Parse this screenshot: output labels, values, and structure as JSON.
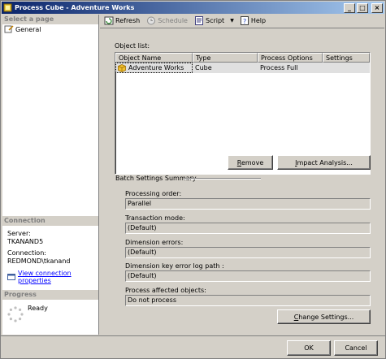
{
  "window": {
    "title": "Process Cube - Adventure Works",
    "controls": {
      "minimize": "_",
      "maximize": "□",
      "close": "×"
    }
  },
  "left_pane": {
    "select_page_heading": "Select a page",
    "pages": [
      {
        "label": "General",
        "icon": "page-icon"
      }
    ],
    "connection": {
      "heading": "Connection",
      "server_label": "Server:",
      "server_value": "TKANAND5",
      "connection_label": "Connection:",
      "connection_value": "REDMOND\\tkanand",
      "view_link": "View connection properties",
      "view_link_icon": "properties-icon"
    },
    "progress": {
      "heading": "Progress",
      "status": "Ready",
      "icon": "spinner-icon"
    }
  },
  "toolbar": {
    "refresh": "Refresh",
    "schedule": "Schedule",
    "script": "Script",
    "help": "Help"
  },
  "object_list": {
    "label": "Object list:",
    "columns": [
      "Object Name",
      "Type",
      "Process Options",
      "Settings"
    ],
    "rows": [
      {
        "name": "Adventure Works",
        "type": "Cube",
        "process_option": "Process Full",
        "settings": ""
      }
    ]
  },
  "buttons": {
    "remove": "Remove",
    "impact_analysis": "Impact Analysis...",
    "change_settings": "Change Settings...",
    "ok": "OK",
    "cancel": "Cancel"
  },
  "batch_summary": {
    "heading": "Batch Settings Summary",
    "processing_order_label": "Processing order:",
    "processing_order_value": "Parallel",
    "transaction_mode_label": "Transaction mode:",
    "transaction_mode_value": "(Default)",
    "dimension_errors_label": "Dimension errors:",
    "dimension_errors_value": "(Default)",
    "dimension_key_error_log_label": "Dimension key error log path :",
    "dimension_key_error_log_value": "(Default)",
    "process_affected_label": "Process affected objects:",
    "process_affected_value": "Do not process"
  },
  "colors": {
    "titlebar_start": "#0a246a",
    "titlebar_end": "#a6caf0",
    "face": "#d4d0c8",
    "link": "#0000ff"
  }
}
